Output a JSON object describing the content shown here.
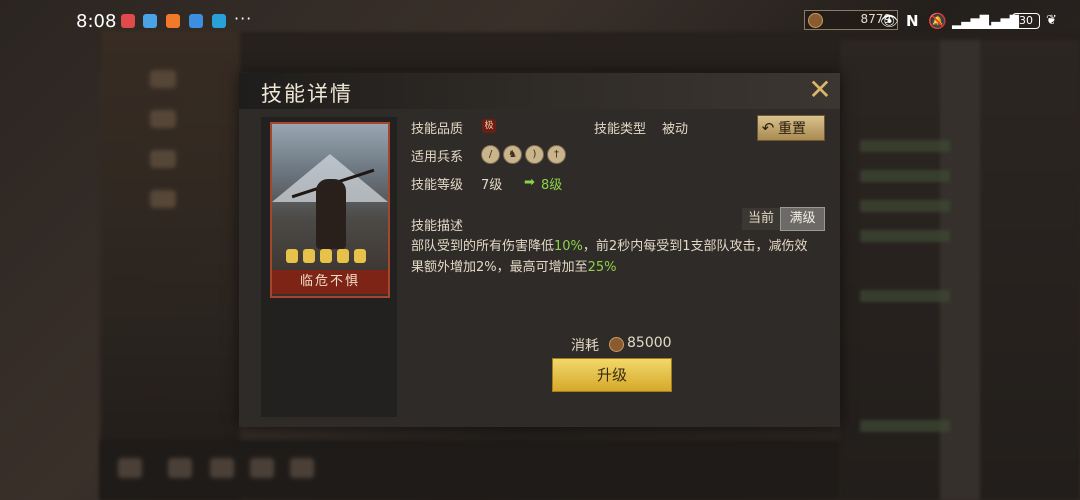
{
  "status_bar": {
    "time": "8:08",
    "more": "···",
    "coin_value": "8779",
    "battery": "30",
    "notif_colors": [
      "#e04a4a",
      "#4aa3e6",
      "#f07a2a",
      "#3c8ee0",
      "#2aa0d8"
    ]
  },
  "dialog": {
    "title": "技能详情",
    "close_icon": "close-x-icon",
    "card": {
      "name": "临危不惧",
      "stars": 5
    },
    "quality_label": "技能品质",
    "quality_badge": "极",
    "type_label": "技能类型",
    "type_value": "被动",
    "troops_label": "适用兵系",
    "troop_icons": [
      "spear-icon",
      "horse-icon",
      "bow-icon",
      "sword-icon"
    ],
    "level_label": "技能等级",
    "level_current": "7级",
    "level_next": "8级",
    "reset_label": "重置",
    "desc_label": "技能描述",
    "seg_current": "当前",
    "seg_max": "满级",
    "desc_part1": "部队受到的所有伤害降低",
    "desc_hl1": "10%",
    "desc_part2": "，前2秒内每受到1支部队攻击，减伤效果额外增加2%，最高可增加至",
    "desc_hl2": "25%",
    "cost_label": "消耗",
    "cost_value": "85000",
    "upgrade_label": "升级"
  }
}
